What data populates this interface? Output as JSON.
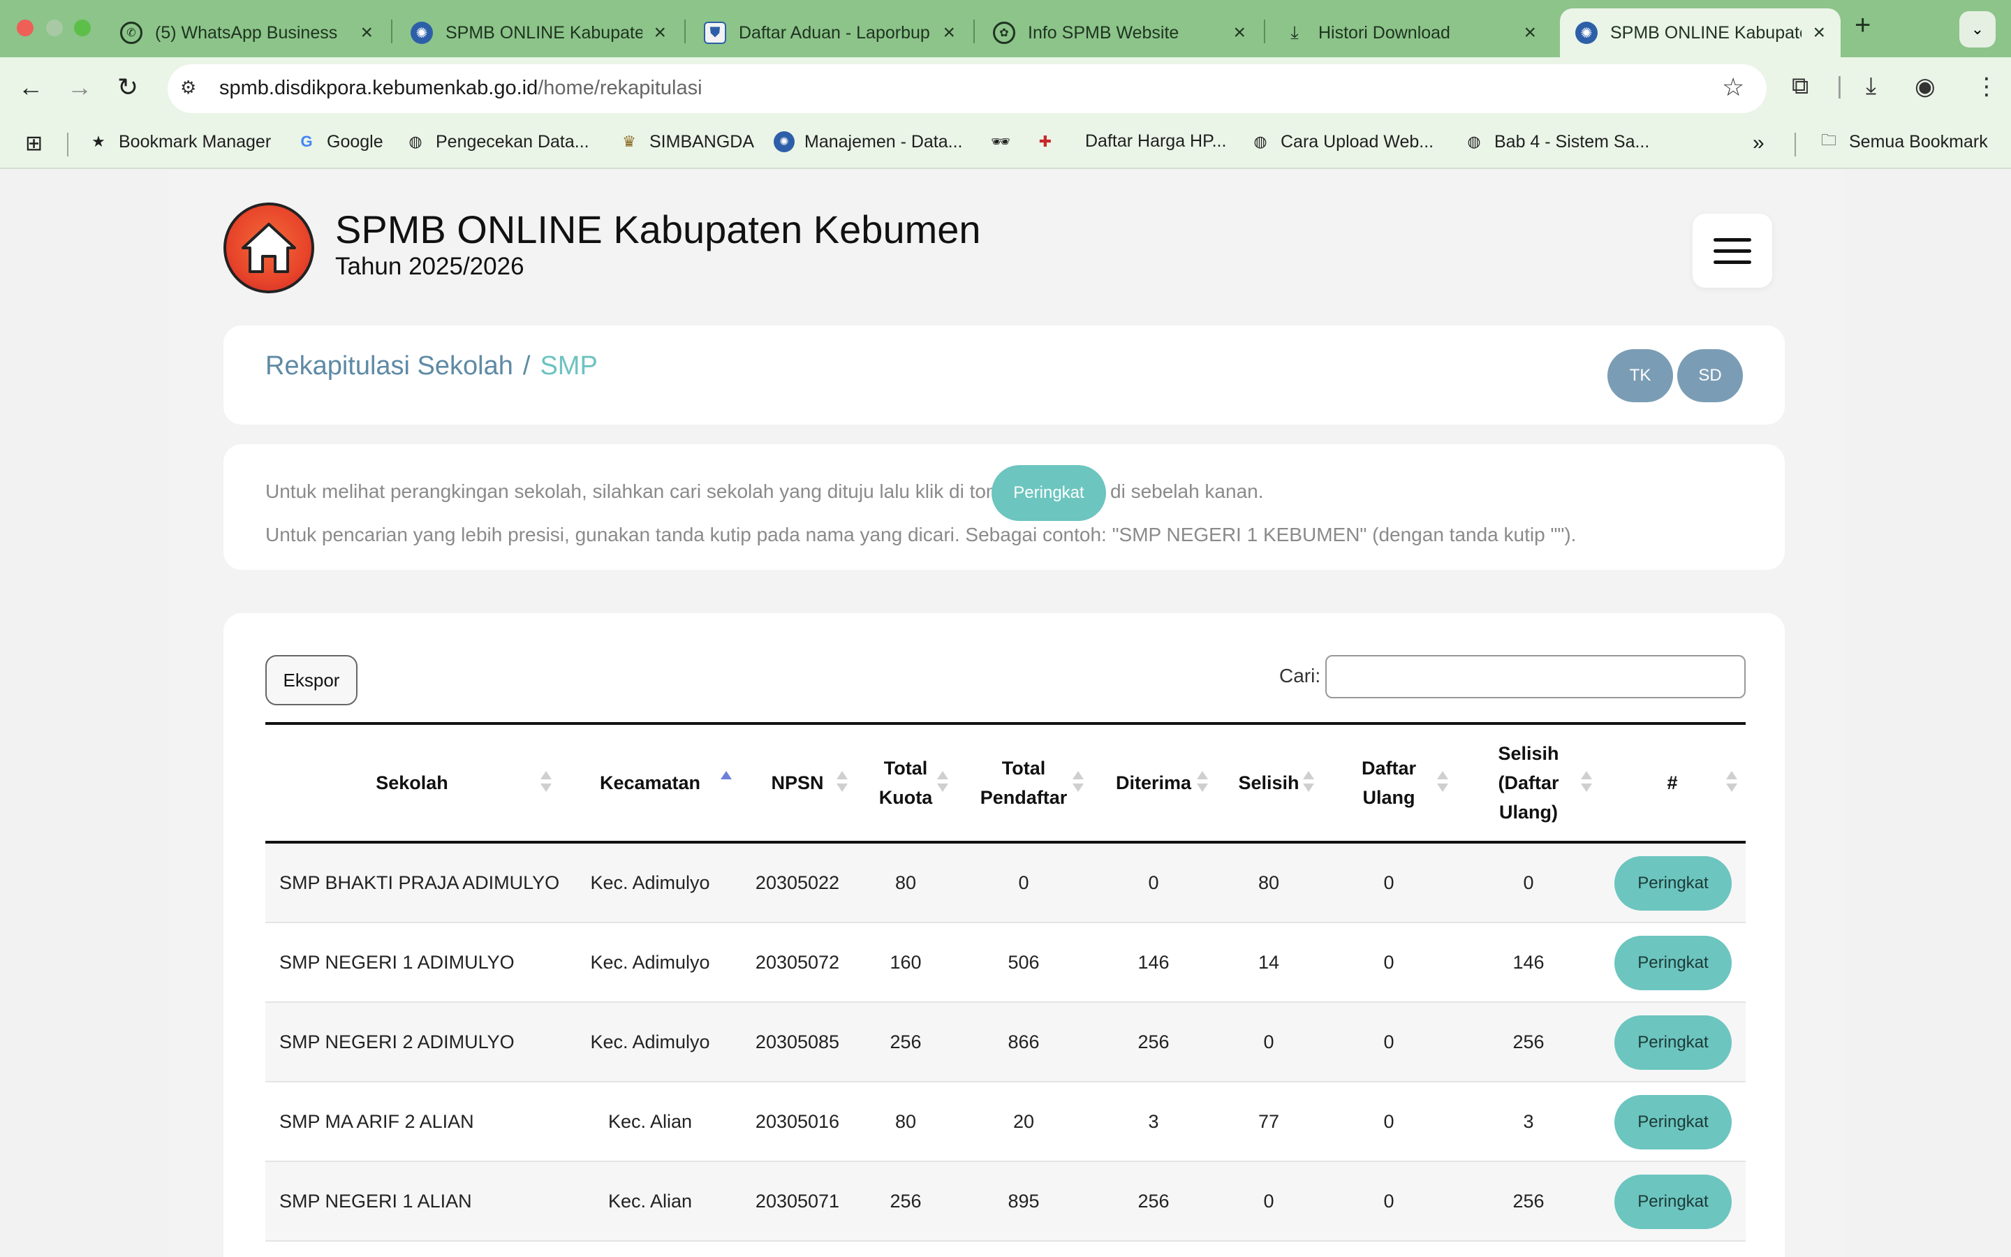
{
  "browser": {
    "tabs": [
      {
        "title": "(5) WhatsApp Business",
        "icon": "whatsapp-icon"
      },
      {
        "title": "SPMB ONLINE Kabupaten Kebumen",
        "icon": "tutwuri-icon"
      },
      {
        "title": "Daftar Aduan - Laporbup",
        "icon": "shield-icon"
      },
      {
        "title": "Info SPMB Website",
        "icon": "chatgpt-icon"
      },
      {
        "title": "Histori Download",
        "icon": "download-icon"
      },
      {
        "title": "SPMB ONLINE Kabupaten Kebumen",
        "icon": "tutwuri-icon"
      }
    ],
    "url_host": "spmb.disdikpora.kebumenkab.go.id",
    "url_path": "/home/rekapitulasi",
    "bookmarks": [
      {
        "label": "Bookmark Manager",
        "icon": "star-icon"
      },
      {
        "label": "Google",
        "icon": "google-icon"
      },
      {
        "label": "Pengecekan Data...",
        "icon": "globe-icon"
      },
      {
        "label": "SIMBANGDA",
        "icon": "emblem-icon"
      },
      {
        "label": "Manajemen - Data...",
        "icon": "tutwuri-icon"
      },
      {
        "label": "",
        "icon": "spy-icon"
      },
      {
        "label": "",
        "icon": "android-icon"
      },
      {
        "label": "Daftar Harga HP...",
        "icon": ""
      },
      {
        "label": "Cara Upload Web...",
        "icon": "globe-icon"
      },
      {
        "label": "Bab 4 - Sistem Sa...",
        "icon": "globe-icon"
      }
    ],
    "all_bookmarks": "Semua Bookmark"
  },
  "header": {
    "title": "SPMB ONLINE Kabupaten Kebumen",
    "year": "Tahun 2025/2026"
  },
  "breadcrumb": {
    "parent": "Rekapitulasi Sekolah",
    "separator": "/",
    "current": "SMP"
  },
  "level_buttons": [
    "TK",
    "SD"
  ],
  "info": {
    "line1_before": "Untuk melihat perangkingan sekolah, silahkan cari sekolah yang dituju lalu klik di tombol",
    "button_label": "Peringkat",
    "line1_after": "di sebelah kanan.",
    "line2": "Untuk pencarian yang lebih presisi, gunakan tanda kutip pada nama yang dicari. Sebagai contoh: \"SMP NEGERI 1 KEBUMEN\" (dengan tanda kutip \"\")."
  },
  "table_controls": {
    "export_label": "Ekspor",
    "search_label": "Cari:",
    "search_value": ""
  },
  "table": {
    "headers": [
      "Sekolah",
      "Kecamatan",
      "NPSN",
      "Total\nKuota",
      "Total\nPendaftar",
      "Diterima",
      "Selisih",
      "Daftar\nUlang",
      "Selisih\n(Daftar\nUlang)",
      "#"
    ],
    "rows": [
      {
        "sekolah": "SMP BHAKTI PRAJA ADIMULYO",
        "kecamatan": "Kec. Adimulyo",
        "npsn": "20305022",
        "kuota": "80",
        "pendaftar": "0",
        "diterima": "0",
        "selisih": "80",
        "daftar_ulang": "0",
        "selisih_du": "0",
        "action": "Peringkat"
      },
      {
        "sekolah": "SMP NEGERI 1 ADIMULYO",
        "kecamatan": "Kec. Adimulyo",
        "npsn": "20305072",
        "kuota": "160",
        "pendaftar": "506",
        "diterima": "146",
        "selisih": "14",
        "daftar_ulang": "0",
        "selisih_du": "146",
        "action": "Peringkat"
      },
      {
        "sekolah": "SMP NEGERI 2 ADIMULYO",
        "kecamatan": "Kec. Adimulyo",
        "npsn": "20305085",
        "kuota": "256",
        "pendaftar": "866",
        "diterima": "256",
        "selisih": "0",
        "daftar_ulang": "0",
        "selisih_du": "256",
        "action": "Peringkat"
      },
      {
        "sekolah": "SMP MA ARIF 2 ALIAN",
        "kecamatan": "Kec. Alian",
        "npsn": "20305016",
        "kuota": "80",
        "pendaftar": "20",
        "diterima": "3",
        "selisih": "77",
        "daftar_ulang": "0",
        "selisih_du": "3",
        "action": "Peringkat"
      },
      {
        "sekolah": "SMP NEGERI 1 ALIAN",
        "kecamatan": "Kec. Alian",
        "npsn": "20305071",
        "kuota": "256",
        "pendaftar": "895",
        "diterima": "256",
        "selisih": "0",
        "daftar_ulang": "0",
        "selisih_du": "256",
        "action": "Peringkat"
      }
    ]
  },
  "colors": {
    "tab_strip": "#8cc48a",
    "toolbar": "#eaf4e7",
    "accent_teal": "#6cc5bf",
    "crumb_blue": "#5e8aa4",
    "pill_blue": "#7a9db5"
  }
}
